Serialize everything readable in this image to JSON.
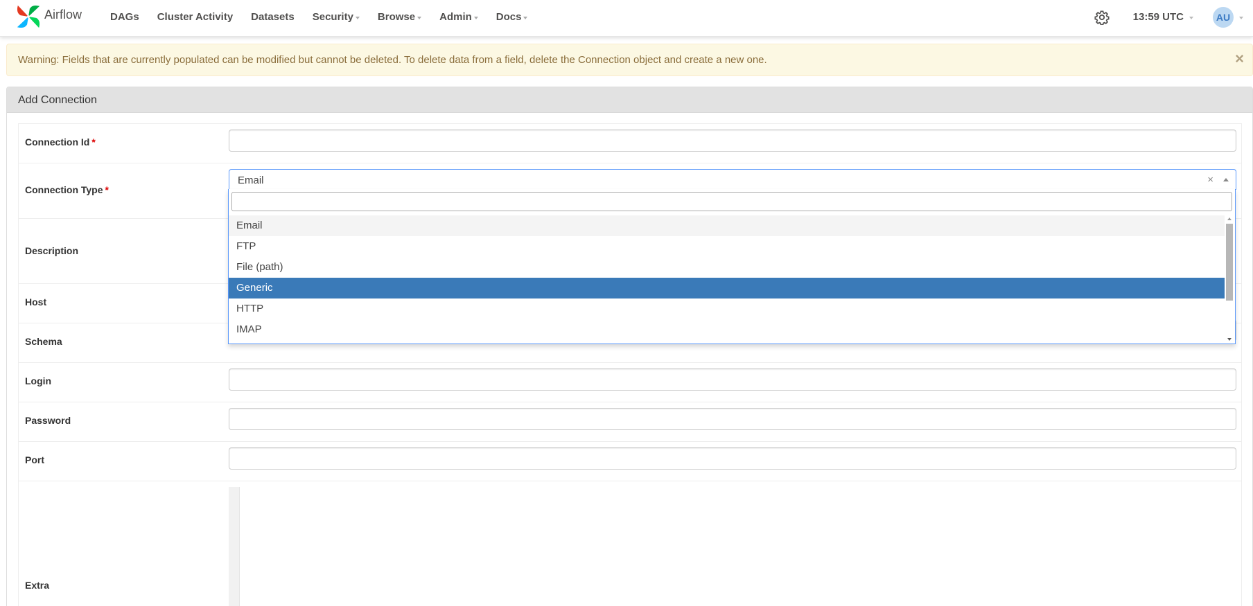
{
  "navbar": {
    "brand": "Airflow",
    "items": [
      {
        "label": "DAGs",
        "dropdown": false
      },
      {
        "label": "Cluster Activity",
        "dropdown": false
      },
      {
        "label": "Datasets",
        "dropdown": false
      },
      {
        "label": "Security",
        "dropdown": true
      },
      {
        "label": "Browse",
        "dropdown": true
      },
      {
        "label": "Admin",
        "dropdown": true
      },
      {
        "label": "Docs",
        "dropdown": true
      }
    ],
    "time": "13:59 UTC",
    "user_initials": "AU"
  },
  "alert": {
    "text": "Warning: Fields that are currently populated can be modified but cannot be deleted. To delete data from a field, delete the Connection object and create a new one.",
    "close": "×"
  },
  "panel": {
    "title": "Add Connection"
  },
  "form": {
    "connection_id": {
      "label": "Connection Id",
      "required": "*",
      "value": ""
    },
    "connection_type": {
      "label": "Connection Type",
      "required": "*",
      "value": "Email",
      "clear": "×"
    },
    "description": {
      "label": "Description"
    },
    "host": {
      "label": "Host"
    },
    "schema": {
      "label": "Schema"
    },
    "login": {
      "label": "Login",
      "value": ""
    },
    "password": {
      "label": "Password",
      "value": ""
    },
    "port": {
      "label": "Port",
      "value": ""
    },
    "extra": {
      "label": "Extra"
    }
  },
  "dropdown": {
    "search_value": "",
    "options": [
      "Email",
      "FTP",
      "File (path)",
      "Generic",
      "HTTP",
      "IMAP"
    ],
    "hovered": "Email",
    "highlighted": "Generic"
  },
  "colors": {
    "highlight": "#3a7ab8",
    "required": "#dd0000",
    "alert_bg": "#fcf8e3"
  }
}
